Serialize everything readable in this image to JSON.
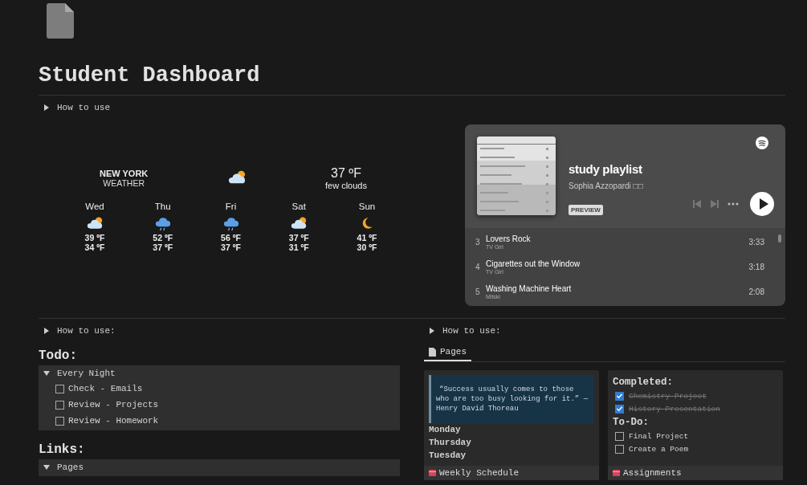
{
  "page": {
    "title": "Student Dashboard",
    "toggle": "How to use"
  },
  "weather": {
    "city": "NEW YORK",
    "subtitle": "WEATHER",
    "current": {
      "kind": "partly-cloudy",
      "temp": "37 ºF",
      "description": "few clouds"
    },
    "forecast": [
      {
        "day": "Wed",
        "kind": "partly-cloudy",
        "high": "39 ºF",
        "low": "34 ºF"
      },
      {
        "day": "Thu",
        "kind": "rain",
        "high": "52 ºF",
        "low": "37 ºF"
      },
      {
        "day": "Fri",
        "kind": "rain",
        "high": "56 ºF",
        "low": "37 ºF"
      },
      {
        "day": "Sat",
        "kind": "partly-cloudy",
        "high": "37 ºF",
        "low": "31 ºF"
      },
      {
        "day": "Sun",
        "kind": "night",
        "high": "41 ºF",
        "low": "30 ºF"
      }
    ]
  },
  "player": {
    "title": "study playlist",
    "artist": "Sophia Azzopardi □□",
    "badge": "PREVIEW",
    "tracks": [
      {
        "number": "3",
        "title": "Lovers Rock",
        "artist": "TV Girl",
        "duration": "3:33"
      },
      {
        "number": "4",
        "title": "Cigarettes out the Window",
        "artist": "TV Girl",
        "duration": "3:18"
      },
      {
        "number": "5",
        "title": "Washing Machine Heart",
        "artist": "Mitski",
        "duration": "2:08"
      }
    ]
  },
  "left": {
    "toggle": "How to use:",
    "todo_heading": "Todo:",
    "todo_group": {
      "label": "Every Night",
      "expanded": true,
      "items": [
        {
          "text": "Check - Emails",
          "checked": false
        },
        {
          "text": "Review - Projects",
          "checked": false
        },
        {
          "text": "Review - Homework",
          "checked": false
        }
      ]
    },
    "links_heading": "Links:",
    "links_group": {
      "label": "Pages",
      "expanded": true
    }
  },
  "right": {
    "toggle": "How to use:",
    "tabs": [
      {
        "label": "Pages",
        "selected": true
      }
    ],
    "cards": [
      {
        "kind": "schedule",
        "quote": "“Success usually comes to those who are too busy looking for it.” — Henry David Thoreau",
        "days": [
          "Monday",
          "Thursday",
          "Tuesday"
        ],
        "title": "Weekly Schedule"
      },
      {
        "kind": "assignments",
        "completed_heading": "Completed:",
        "completed": [
          {
            "text": "Chemistry Project",
            "checked": true
          },
          {
            "text": "History Presentation",
            "checked": true
          }
        ],
        "todo_heading": "To-Do:",
        "todo": [
          {
            "text": "Final Project",
            "checked": false
          },
          {
            "text": "Create a Poem",
            "checked": false
          }
        ],
        "title": "Assignments"
      }
    ]
  }
}
